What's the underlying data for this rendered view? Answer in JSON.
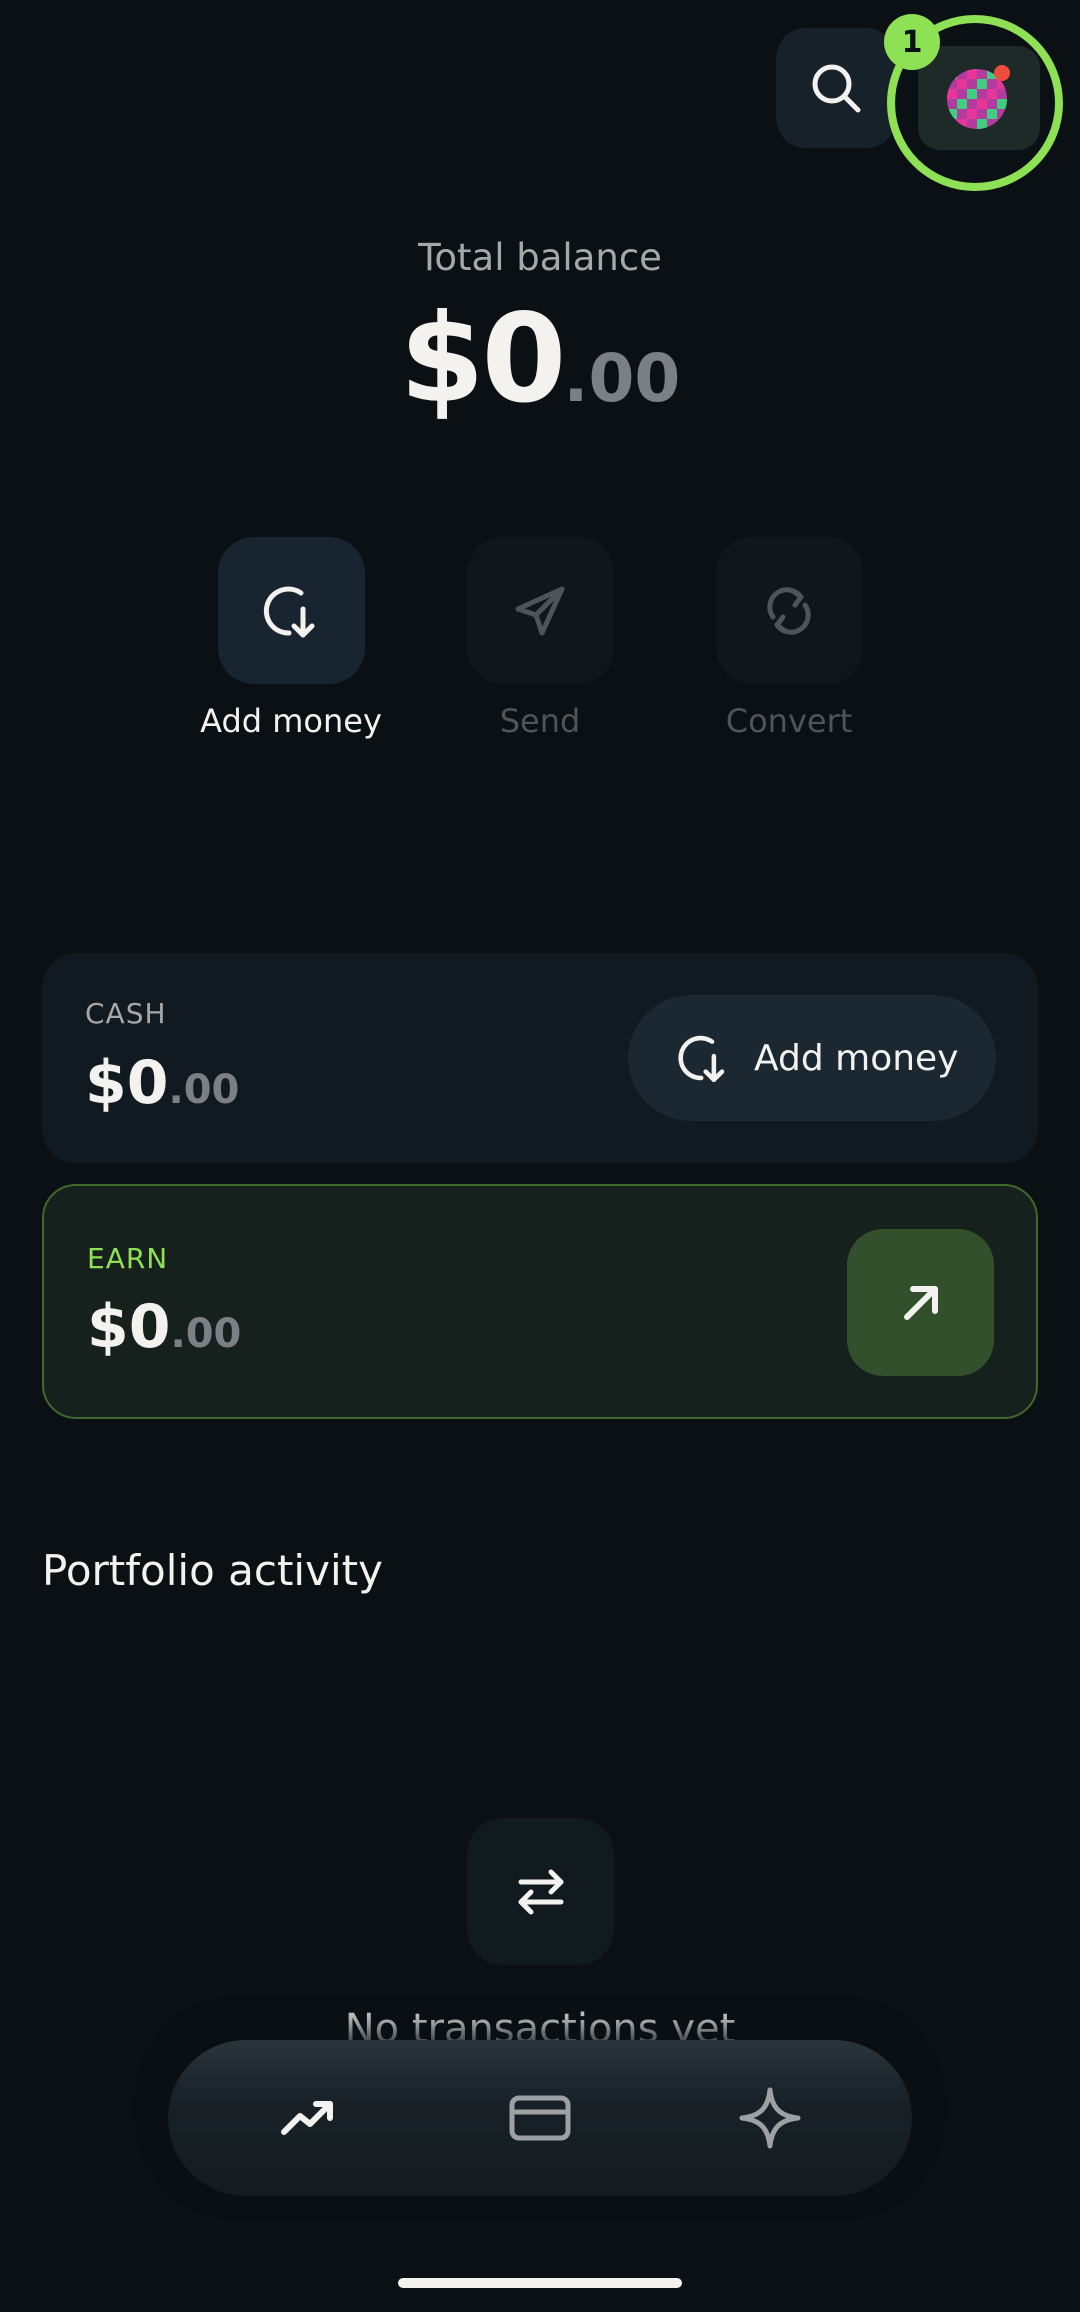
{
  "header": {
    "search_icon": "search-icon",
    "avatar_icon": "pixel-avatar-icon",
    "notification_count": "1",
    "accent_color": "#8ee055"
  },
  "balance": {
    "label": "Total balance",
    "main": "$0",
    "cents": ".00"
  },
  "actions": [
    {
      "label": "Add money",
      "icon": "add-money-icon",
      "enabled": true
    },
    {
      "label": "Send",
      "icon": "send-icon",
      "enabled": false
    },
    {
      "label": "Convert",
      "icon": "convert-icon",
      "enabled": false
    }
  ],
  "cash": {
    "label": "CASH",
    "main": "$0",
    "cents": ".00",
    "button_label": "Add money",
    "button_icon": "add-money-icon"
  },
  "earn": {
    "label": "EARN",
    "main": "$0",
    "cents": ".00",
    "button_icon": "arrow-up-right-icon",
    "label_color": "#8ee055"
  },
  "portfolio": {
    "title": "Portfolio activity",
    "empty_icon": "transfer-icon",
    "empty_text": "No transactions yet"
  },
  "nav": [
    {
      "name": "trending-icon"
    },
    {
      "name": "card-icon"
    },
    {
      "name": "sparkle-icon"
    }
  ]
}
